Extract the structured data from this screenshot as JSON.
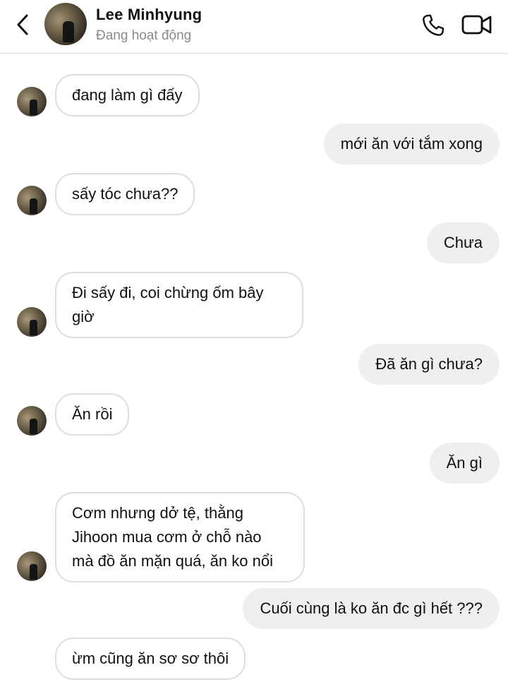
{
  "header": {
    "name": "Lee Minhyung",
    "status": "Đang hoạt động",
    "back_icon": "chevron-left-icon",
    "call_icon": "phone-icon",
    "video_icon": "video-camera-icon"
  },
  "messages": [
    {
      "side": "in",
      "text": "đang làm gì đấy"
    },
    {
      "side": "out",
      "text": "mới ăn với tắm xong"
    },
    {
      "side": "in",
      "text": "sấy tóc chưa??"
    },
    {
      "side": "out",
      "text": "Chưa"
    },
    {
      "side": "in",
      "lines": [
        "Đi sấy đi, coi chừng ốm bây",
        "giờ"
      ]
    },
    {
      "side": "out",
      "text": "Đã ăn gì chưa?"
    },
    {
      "side": "in",
      "text": "Ăn rồi"
    },
    {
      "side": "out",
      "text": "Ăn gì"
    },
    {
      "side": "in",
      "lines": [
        "Cơm nhưng dở tệ, thằng",
        "Jihoon mua cơm ở chỗ nào",
        "mà đồ ăn mặn quá, ăn ko nổi"
      ]
    },
    {
      "side": "out",
      "text": "Cuối cùng là ko ăn đc gì hết ???"
    },
    {
      "side": "in",
      "text": "ừm cũng ăn sơ sơ thôi"
    }
  ]
}
